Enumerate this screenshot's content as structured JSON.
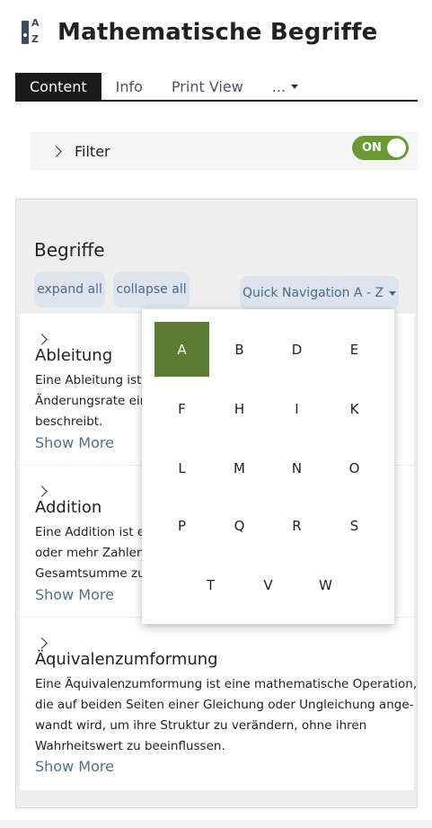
{
  "header": {
    "title": "Mathematische Begriffe",
    "icon": "az-dictionary-icon",
    "icon_letters": {
      "top": "A",
      "bottom": "Z"
    }
  },
  "tabs": [
    {
      "label": "Content",
      "active": true
    },
    {
      "label": "Info"
    },
    {
      "label": "Print View"
    },
    {
      "label": "..."
    }
  ],
  "filter": {
    "label": "Filter",
    "toggle_label": "ON",
    "toggle_on": true,
    "toggle_color": "#6a9a32"
  },
  "glossary": {
    "heading": "Begriffe",
    "expand_all": "expand all",
    "collapse_all": "collapse all",
    "quick_nav_label": "Quick Navigation A - Z",
    "entries": [
      {
        "title": "Ableitung",
        "lines": [
          "Eine Ableitung ist e",
          "Änderungsrate eine",
          "beschreibt."
        ],
        "show_more": "Show More"
      },
      {
        "title": "Addition",
        "lines": [
          "Eine Addition ist ein",
          "oder mehr Zahlen z",
          "Gesamtsumme zu e"
        ],
        "show_more": "Show More"
      },
      {
        "title": "Äquivalenzumformung",
        "lines": [
          "Eine Äquivalenzumformung ist eine mathematische Operation,",
          "die auf beiden Seiten einer Gleichung oder Ungleichung ange-",
          "wandt wird, um ihre Struktur zu verändern, ohne ihren",
          "Wahrheitswert zu beeinflussen."
        ],
        "show_more": "Show More"
      }
    ]
  },
  "quick_nav": {
    "letters": [
      "A",
      "B",
      "D",
      "E",
      "F",
      "H",
      "I",
      "K",
      "L",
      "M",
      "N",
      "O",
      "P",
      "Q",
      "R",
      "S",
      "T",
      "V",
      "W"
    ],
    "active": "A",
    "active_color": "#5a7d33"
  }
}
